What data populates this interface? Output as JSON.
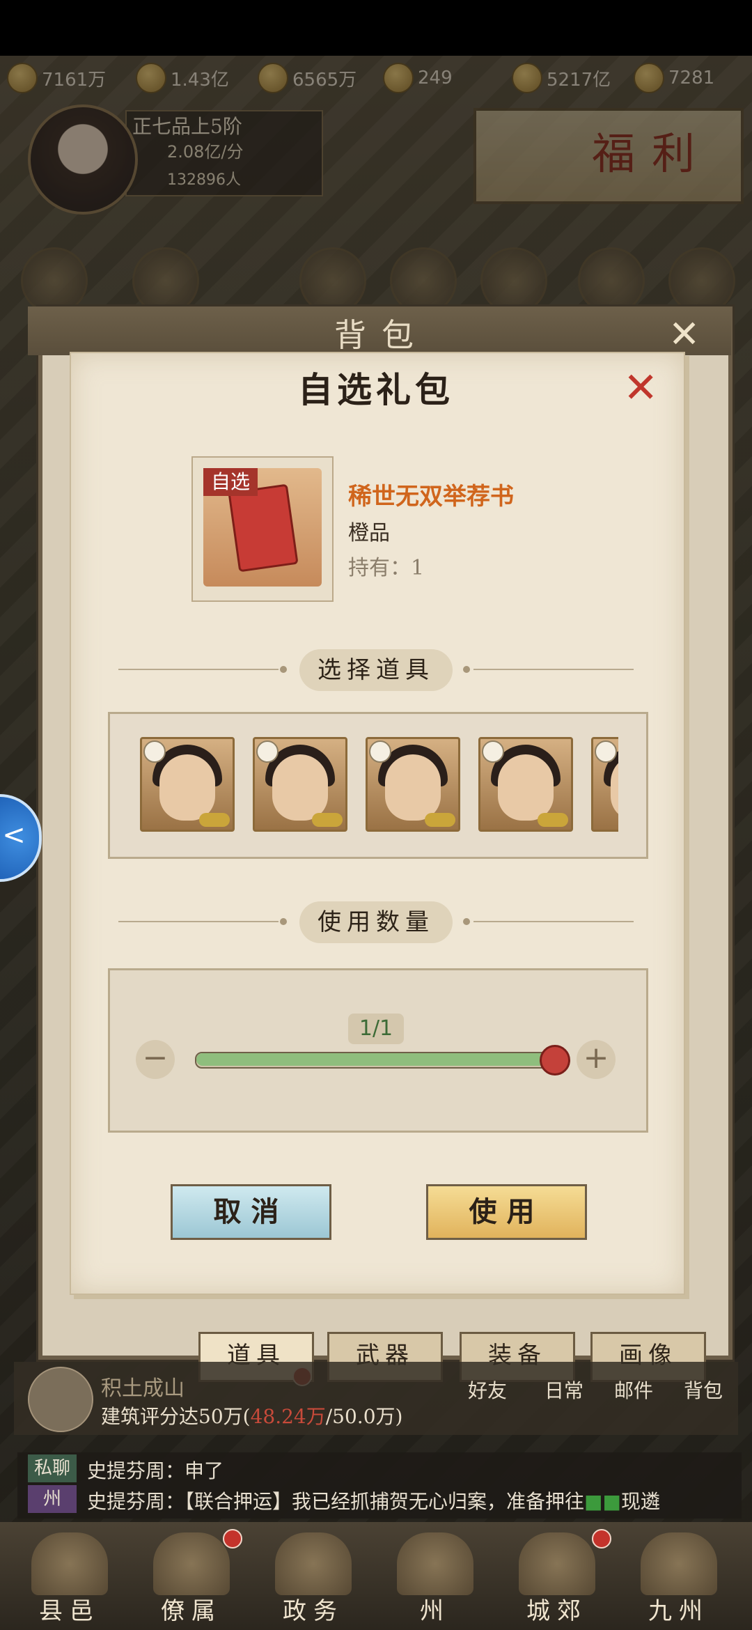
{
  "resources": [
    "7161万",
    "1.43亿",
    "6565万",
    "249",
    "5217亿",
    "7281"
  ],
  "player": {
    "rank": "正七品上5阶",
    "rate": "2.08亿/分",
    "population": "132896人"
  },
  "banner": {
    "fuli": "福利"
  },
  "bag": {
    "title": "背包",
    "close": "✕"
  },
  "dialog": {
    "title": "自选礼包",
    "close": "✕",
    "item": {
      "tag": "自选",
      "name": "稀世无双举荐书",
      "grade": "橙品",
      "owned": "持有：1"
    },
    "section_select": "选择道具",
    "section_quantity": "使用数量",
    "quantity": {
      "value": "1/1",
      "fraction": 1.0,
      "minus": "−",
      "plus": "+"
    },
    "buttons": {
      "cancel": "取消",
      "use": "使用"
    }
  },
  "tabs": [
    "道具",
    "武器",
    "装备",
    "画像"
  ],
  "building": {
    "title": "积土成山",
    "desc_prefix": "建筑评分达50万(",
    "progress": "48.24万",
    "desc_suffix": "/50.0万)"
  },
  "quick_links": [
    "好友",
    "日常",
    "邮件",
    "背包"
  ],
  "chat": {
    "line1": {
      "channel": "私聊",
      "text": "史提芬周：申了"
    },
    "line2": {
      "channel": "州",
      "text": "史提芬周：【联合押运】我已经抓捕贺无心归案，准备押往",
      "tail": "现遴"
    }
  },
  "bottom_nav": [
    "县邑",
    "僚属",
    "政务",
    "州",
    "城郊",
    "九州"
  ],
  "side": {
    "icon": "<"
  },
  "colors": {
    "accent_red": "#c4413a",
    "orange_item": "#d0651c",
    "slider_green": "#8fbe7d"
  }
}
